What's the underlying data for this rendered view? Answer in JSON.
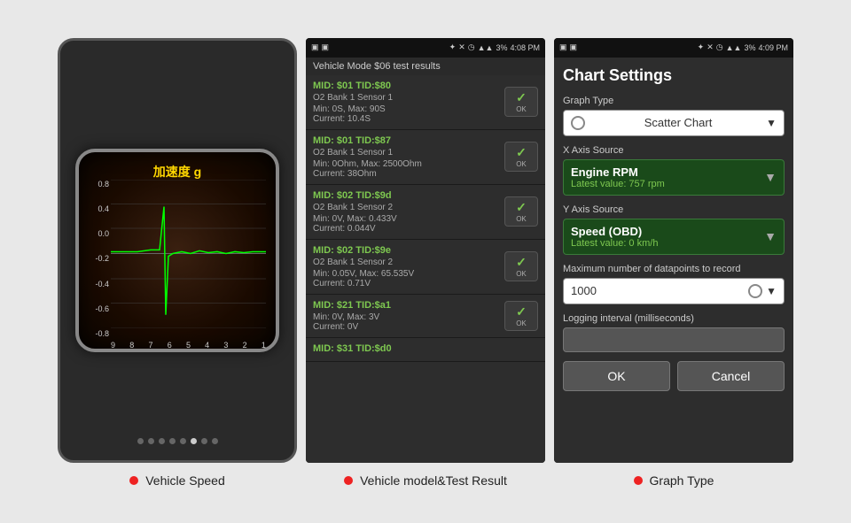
{
  "screen1": {
    "chart_label": "加速度 g",
    "y_labels": [
      "0.8",
      "0.4",
      "0.0",
      "-0.2",
      "-0.4",
      "-0.6",
      "-0.8"
    ],
    "x_labels": [
      "9",
      "8",
      "7",
      "6",
      "5",
      "4",
      "3",
      "2",
      "1"
    ],
    "dots": [
      false,
      false,
      false,
      false,
      false,
      true,
      false,
      false
    ]
  },
  "screen2": {
    "status_time": "4:08 PM",
    "battery": "3%",
    "header": "Vehicle Mode $06 test results",
    "items": [
      {
        "mid": "MID: $01 TID:$80",
        "sub": "O2 Bank 1 Sensor 1",
        "values": "Min: 0S, Max: 90S\nCurrent: 10.4S"
      },
      {
        "mid": "MID: $01 TID:$87",
        "sub": "O2 Bank 1 Sensor 1",
        "values": "Min: 0Ohm, Max: 2500Ohm\nCurrent: 38Ohm"
      },
      {
        "mid": "MID: $02 TID:$9d",
        "sub": "O2 Bank 1 Sensor 2",
        "values": "Min: 0V, Max: 0.433V\nCurrent: 0.044V"
      },
      {
        "mid": "MID: $02 TID:$9e",
        "sub": "O2 Bank 1 Sensor 2",
        "values": "Min: 0.05V, Max: 65.535V\nCurrent: 0.71V"
      },
      {
        "mid": "MID: $21 TID:$a1",
        "sub": "",
        "values": "Min: 0V, Max: 3V\nCurrent: 0V"
      },
      {
        "mid": "MID: $31 TID:$d0",
        "sub": "",
        "values": ""
      }
    ]
  },
  "screen3": {
    "status_time": "4:09 PM",
    "battery": "3%",
    "title": "Chart Settings",
    "graph_type_label": "Graph Type",
    "graph_type_value": "Scatter Chart",
    "x_axis_label": "X Axis Source",
    "x_axis_value": "Engine RPM",
    "x_axis_latest": "Latest value: 757 rpm",
    "y_axis_label": "Y Axis Source",
    "y_axis_value": "Speed (OBD)",
    "y_axis_latest": "Latest value: 0 km/h",
    "max_datapoints_label": "Maximum number of datapoints to record",
    "max_datapoints_value": "1000",
    "logging_label": "Logging interval (milliseconds)",
    "ok_btn": "OK",
    "cancel_btn": "Cancel"
  },
  "captions": [
    "Vehicle Speed",
    "Vehicle model&Test Result",
    "Graph Type"
  ]
}
